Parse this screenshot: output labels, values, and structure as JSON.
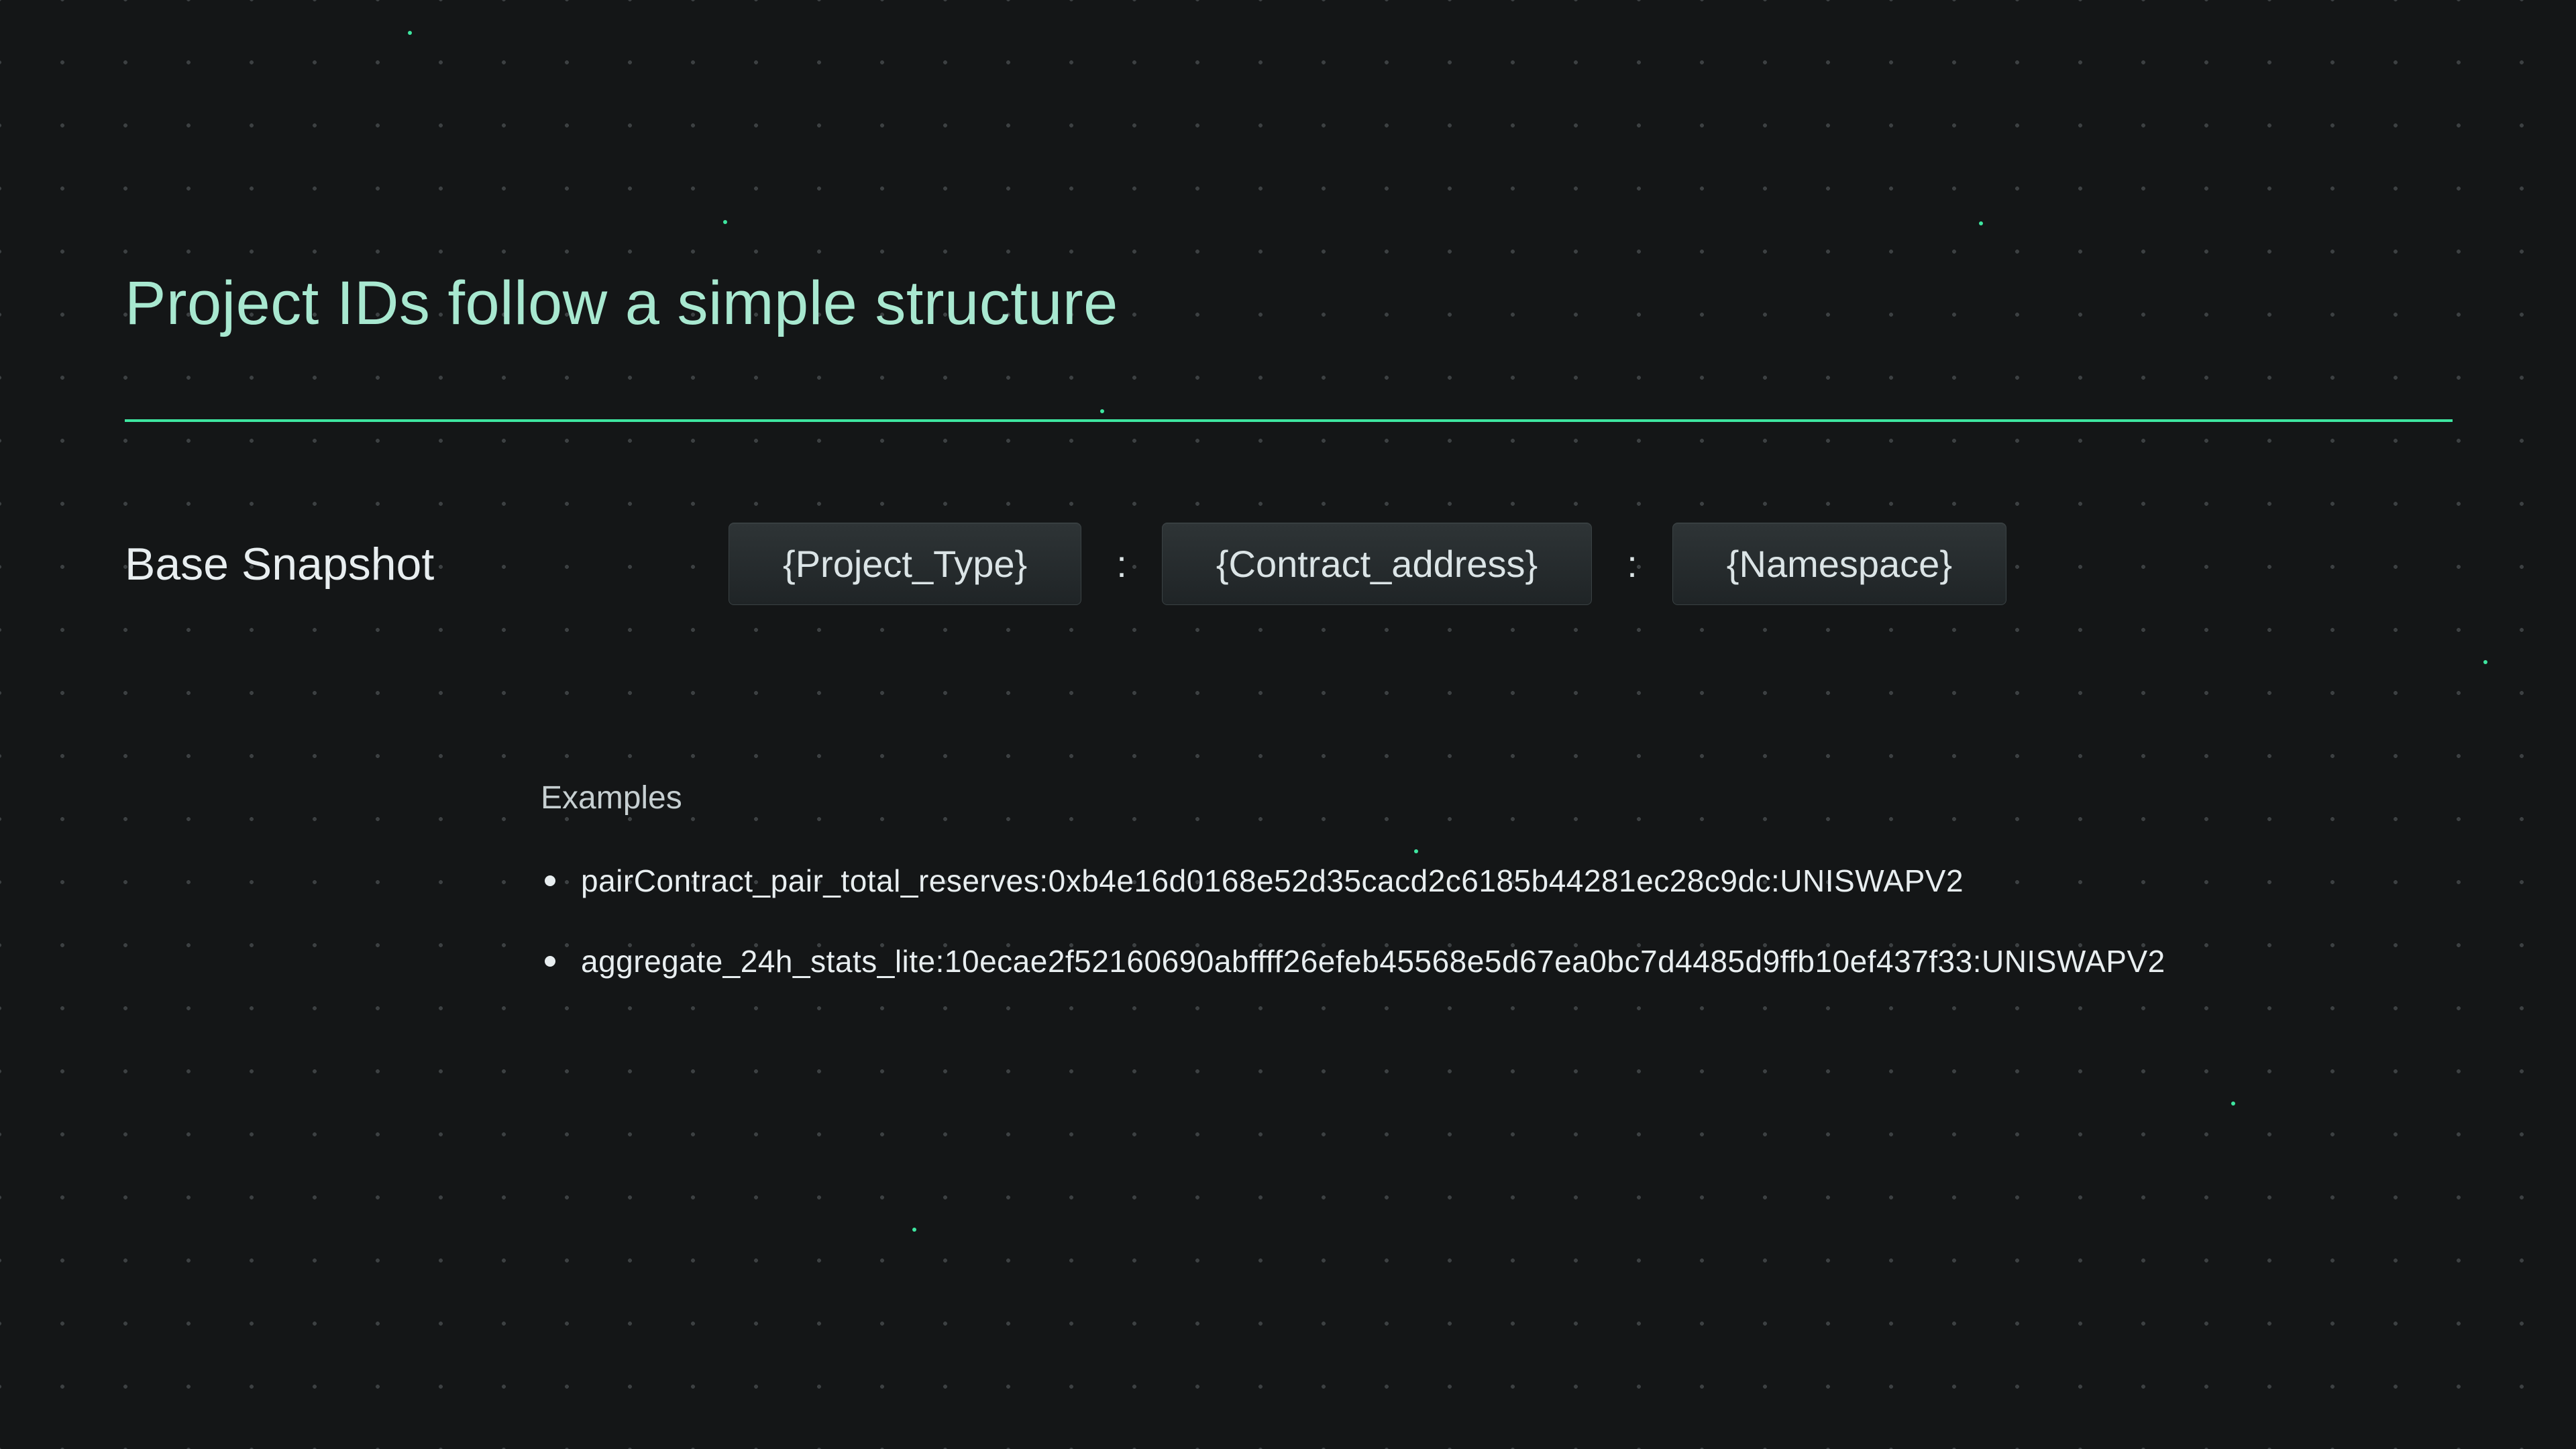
{
  "title": "Project IDs follow a simple structure",
  "row_label": "Base Snapshot",
  "tokens": {
    "project_type": "{Project_Type}",
    "contract_address": "{Contract_address}",
    "namespace": "{Namespace}"
  },
  "separator": ":",
  "examples_heading": "Examples",
  "examples": [
    "pairContract_pair_total_reserves:0xb4e16d0168e52d35cacd2c6185b44281ec28c9dc:UNISWAPV2",
    "aggregate_24h_stats_lite:10ecae2f52160690abffff26efeb45568e5d67ea0bc7d4485d9ffb10ef437f33:UNISWAPV2"
  ],
  "colors": {
    "accent": "#3ee6a0",
    "title": "#a8e8d0",
    "text": "#e8eef0",
    "bg": "#141617"
  }
}
